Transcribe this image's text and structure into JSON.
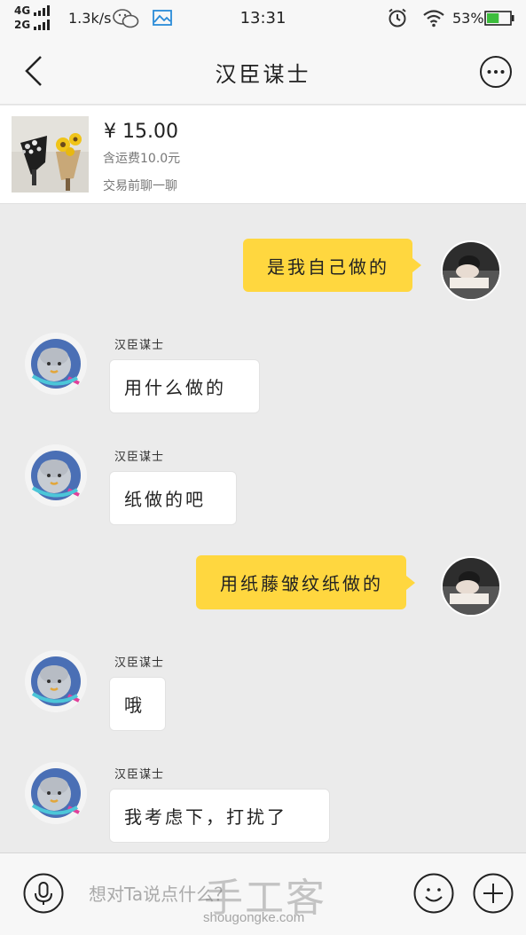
{
  "status_bar": {
    "network_top": "4G",
    "network_bottom": "2G",
    "speed": "1.3k/s",
    "time": "13:31",
    "battery": "53%"
  },
  "header": {
    "title": "汉臣谋士"
  },
  "product": {
    "price": "¥ 15.00",
    "shipping": "含运费10.0元",
    "hint": "交易前聊一聊"
  },
  "messages": [
    {
      "side": "right",
      "text": "是我自己做的"
    },
    {
      "side": "left",
      "sender": "汉臣谋士",
      "text": "用什么做的"
    },
    {
      "side": "left",
      "sender": "汉臣谋士",
      "text": "纸做的吧"
    },
    {
      "side": "right",
      "text": "用纸藤皱纹纸做的"
    },
    {
      "side": "left",
      "sender": "汉臣谋士",
      "text": "哦"
    },
    {
      "side": "left",
      "sender": "汉臣谋士",
      "text": "我考虑下，打扰了"
    }
  ],
  "input": {
    "placeholder": "想对Ta说点什么？"
  },
  "watermark": {
    "main": "手工客",
    "url": "shougongke.com"
  },
  "colors": {
    "chat_background": "#ebebeb",
    "outgoing_bubble": "#ffd73f",
    "incoming_bubble": "#ffffff",
    "battery_fill": "#3cbd3c"
  }
}
